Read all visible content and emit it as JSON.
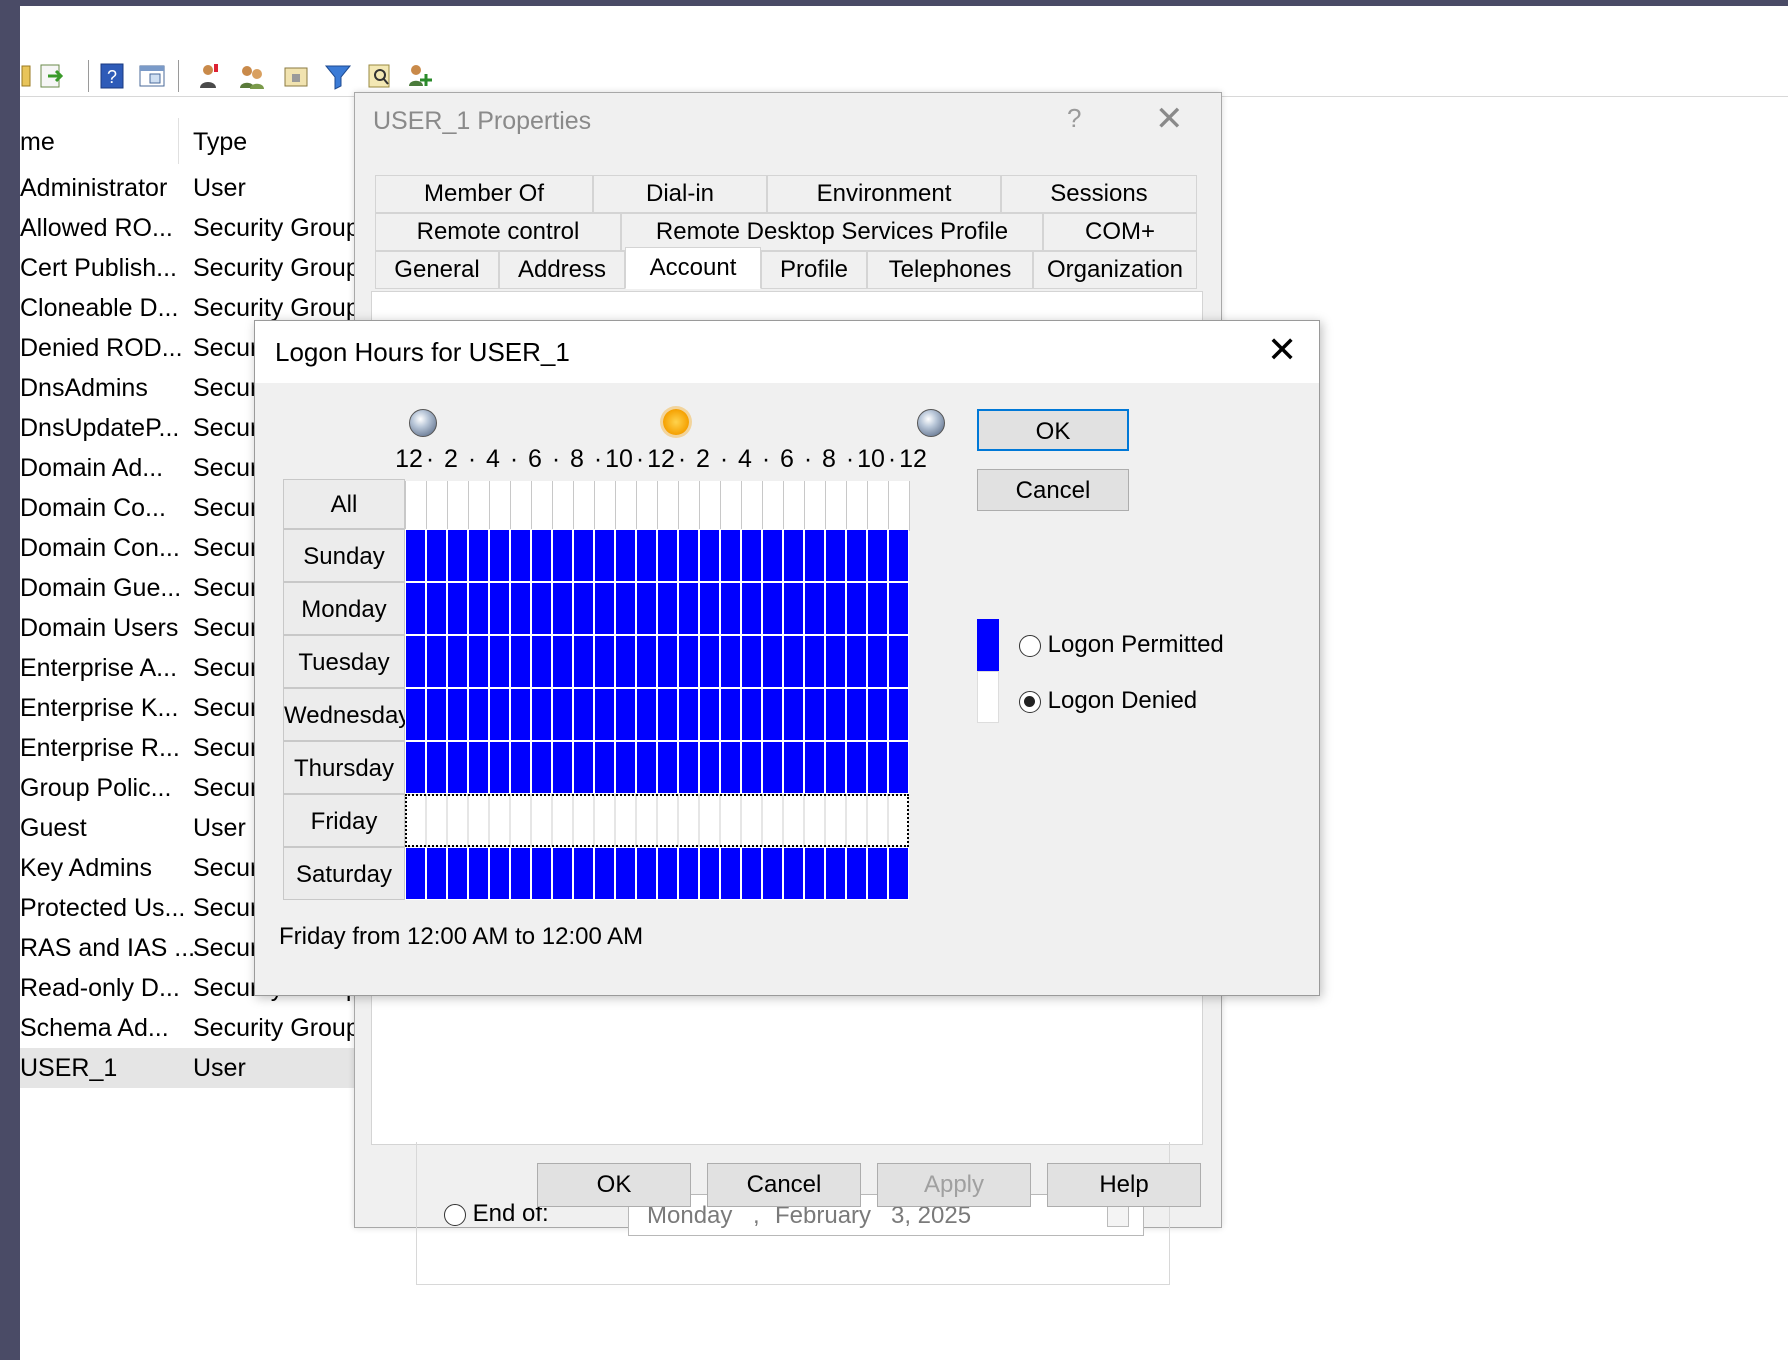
{
  "list": {
    "headers": {
      "name": "me",
      "type": "Type"
    },
    "rows": [
      {
        "name": "Administrator",
        "type": "User"
      },
      {
        "name": "Allowed RO...",
        "type": "Security Group"
      },
      {
        "name": "Cert Publish...",
        "type": "Security Group"
      },
      {
        "name": "Cloneable D...",
        "type": "Security Group"
      },
      {
        "name": "Denied ROD...",
        "type": "Secur"
      },
      {
        "name": "DnsAdmins",
        "type": "Secur"
      },
      {
        "name": "DnsUpdateP...",
        "type": "Secur"
      },
      {
        "name": "Domain Ad...",
        "type": "Secur"
      },
      {
        "name": "Domain Co...",
        "type": "Secur"
      },
      {
        "name": "Domain Con...",
        "type": "Secur"
      },
      {
        "name": "Domain Gue...",
        "type": "Secur"
      },
      {
        "name": "Domain Users",
        "type": "Secur"
      },
      {
        "name": "Enterprise A...",
        "type": "Secur"
      },
      {
        "name": "Enterprise K...",
        "type": "Secur"
      },
      {
        "name": "Enterprise R...",
        "type": "Secur"
      },
      {
        "name": "Group Polic...",
        "type": "Secur"
      },
      {
        "name": "Guest",
        "type": "User"
      },
      {
        "name": "Key Admins",
        "type": "Secur"
      },
      {
        "name": "Protected Us...",
        "type": "Secur"
      },
      {
        "name": "RAS and IAS ...",
        "type": "Secur"
      },
      {
        "name": "Read-only D...",
        "type": "Security Group"
      },
      {
        "name": "Schema Ad...",
        "type": "Security Group"
      },
      {
        "name": "USER_1",
        "type": "User"
      }
    ]
  },
  "props": {
    "title": "USER_1 Properties",
    "help": "?",
    "close": "✕",
    "tab_rows": [
      [
        "Member Of",
        "Dial-in",
        "Environment",
        "Sessions"
      ],
      [
        "Remote control",
        "Remote Desktop Services Profile",
        "COM+"
      ],
      [
        "General",
        "Address",
        "Account",
        "Profile",
        "Telephones",
        "Organization"
      ]
    ],
    "end_of_label": "End of:",
    "date": {
      "day": "Monday",
      "sep": ",",
      "month": "February",
      "rest": "3, 2025"
    },
    "buttons": {
      "ok": "OK",
      "cancel": "Cancel",
      "apply": "Apply",
      "help": "Help"
    }
  },
  "logon": {
    "title": "Logon Hours for USER_1",
    "close": "✕",
    "time_labels": [
      "12",
      "·",
      "2",
      "·",
      "4",
      "·",
      "6",
      "·",
      "8",
      "·",
      "10",
      "·",
      "12",
      "·",
      "2",
      "·",
      "4",
      "·",
      "6",
      "·",
      "8",
      "·",
      "10",
      "·",
      "12"
    ],
    "all_label": "All",
    "days": [
      {
        "label": "Sunday",
        "permitted": true
      },
      {
        "label": "Monday",
        "permitted": true
      },
      {
        "label": "Tuesday",
        "permitted": true
      },
      {
        "label": "Wednesday",
        "permitted": true
      },
      {
        "label": "Thursday",
        "permitted": true
      },
      {
        "label": "Friday",
        "permitted": false
      },
      {
        "label": "Saturday",
        "permitted": true
      }
    ],
    "hours_per_day": 24,
    "buttons": {
      "ok": "OK",
      "cancel": "Cancel"
    },
    "legend": {
      "permitted": "Logon Permitted",
      "denied": "Logon Denied",
      "selected": "denied"
    },
    "status": "Friday from 12:00 AM to 12:00 AM"
  },
  "colors": {
    "permitted": "#0000ff",
    "denied": "#ffffff",
    "frame": "#4a4b66"
  }
}
